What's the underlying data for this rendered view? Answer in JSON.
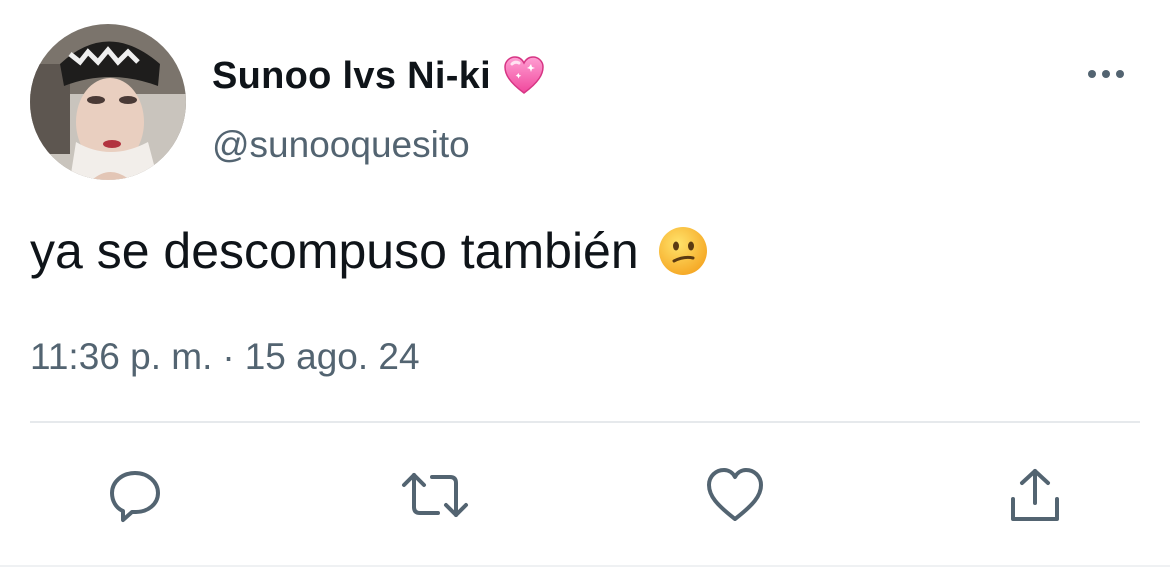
{
  "tweet": {
    "display_name": "Sunoo lvs Ni-ki",
    "name_emoji_icon": "pink-heart-icon",
    "handle": "@sunooquesito",
    "text": "ya se descompuso también",
    "text_emoji_icon": "neutral-face-icon",
    "time": "11:36 p. m.",
    "separator": "·",
    "date": "15 ago. 24"
  },
  "actions": [
    {
      "name": "reply",
      "icon": "reply-icon"
    },
    {
      "name": "retweet",
      "icon": "retweet-icon"
    },
    {
      "name": "like",
      "icon": "heart-icon"
    },
    {
      "name": "share",
      "icon": "share-icon"
    }
  ],
  "colors": {
    "text_primary": "#0f1419",
    "text_secondary": "#536471",
    "icon": "#536471",
    "divider": "#e6e9ec",
    "background": "#ffffff"
  }
}
